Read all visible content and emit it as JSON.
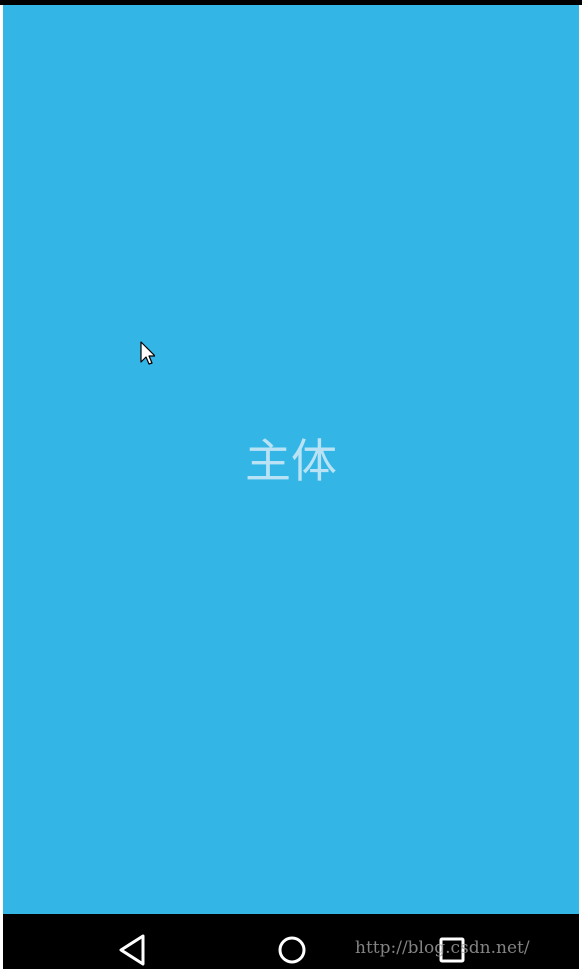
{
  "main": {
    "body_label": "主体"
  },
  "navigation": {
    "back_icon": "back-triangle-icon",
    "home_icon": "home-circle-icon",
    "recents_icon": "recents-square-icon"
  },
  "watermark": {
    "text": "http://blog.csdn.net/"
  },
  "colors": {
    "content_background": "#33b5e5",
    "label_text": "#b9e3f5",
    "navigation_bar": "#000000",
    "navigation_icons": "#ffffff"
  }
}
